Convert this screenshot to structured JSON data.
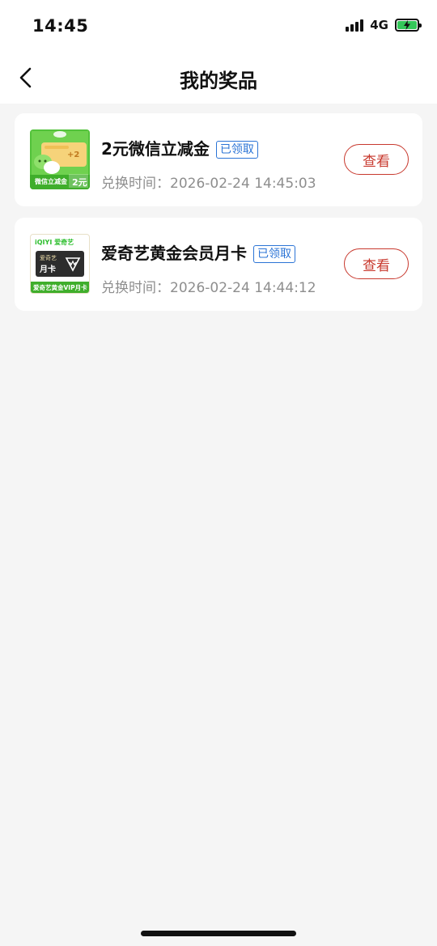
{
  "status_bar": {
    "time": "14:45",
    "network": "4G"
  },
  "header": {
    "title": "我的奖品"
  },
  "prizes": [
    {
      "name": "2元微信立减金",
      "badge": "已领取",
      "time_label": "兑换时间：",
      "time_value": "2026-02-24 14:45:03",
      "button": "查看",
      "thumb": {
        "bottom_label": "微信立减金",
        "amount": "2元",
        "plus": "+2"
      }
    },
    {
      "name": "爱奇艺黄金会员月卡",
      "badge": "已领取",
      "time_label": "兑换时间：",
      "time_value": "2026-02-24 14:44:12",
      "button": "查看",
      "thumb": {
        "brand": "iQIYI 爱奇艺",
        "card_line1": "爱奇艺",
        "card_line2": "月卡",
        "bottom_label": "爱奇艺黄金VIP月卡"
      }
    }
  ],
  "colors": {
    "accent_red": "#c8392e",
    "badge_blue": "#2b74d6",
    "wechat_green": "#52c23a"
  }
}
